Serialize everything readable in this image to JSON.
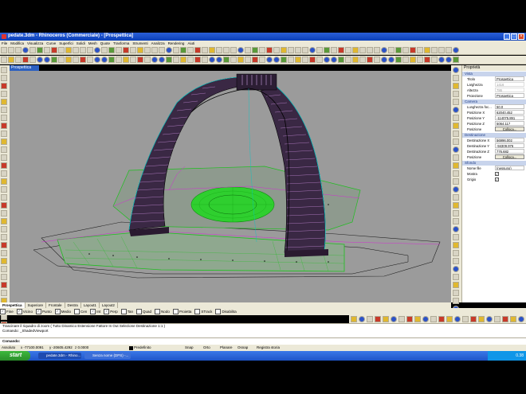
{
  "window": {
    "title": "pedate.3dm - Rhinoceros (Commerciale) - [Prospettica]"
  },
  "menu": [
    "File",
    "Modifica",
    "Visualizza",
    "Curve",
    "Superfici",
    "Solidi",
    "Mesh",
    "Quote",
    "Trasforma",
    "Strumenti",
    "Analizza",
    "Rendering",
    "Aiuti"
  ],
  "viewport": {
    "label": "Prospettica"
  },
  "properties": {
    "header": "Proprietà",
    "sections": {
      "view": "Vista",
      "camera": "Camera",
      "target": "Destinazione",
      "background": "Sfondo"
    },
    "view_rows": [
      {
        "k": "Titolo",
        "v": "Prospettica",
        "disabled": false
      },
      {
        "k": "Larghezza",
        "v": "1416",
        "disabled": true
      },
      {
        "k": "Altezza",
        "v": "786",
        "disabled": true
      },
      {
        "k": "Proiezione",
        "v": "Prospettica",
        "disabled": false
      }
    ],
    "camera_rows": [
      {
        "k": "Lunghezza foc...",
        "v": "50.0"
      },
      {
        "k": "Posizione X",
        "v": "62040.452"
      },
      {
        "k": "Posizione Y",
        "v": "-114075.891"
      },
      {
        "k": "Posizione Z",
        "v": "5064.117"
      }
    ],
    "camera_button_label": "Posizione",
    "camera_button": "Colloca...",
    "target_rows": [
      {
        "k": "Destinazione X",
        "v": "56996.002"
      },
      {
        "k": "Destinazione Y",
        "v": "-94309.976"
      },
      {
        "k": "Destinazione Z",
        "v": "776.682"
      }
    ],
    "target_button_label": "Posizione",
    "target_button": "Colloca...",
    "background_rows": [
      {
        "k": "Nome file",
        "v": "(nessuno)"
      },
      {
        "k": "Mostra",
        "v": "✓"
      },
      {
        "k": "Grigio",
        "v": "✓"
      }
    ]
  },
  "viewport_tabs": [
    "Prospettica",
    "Superiore",
    "Frontale",
    "Destra",
    "Layout1",
    "Layout2"
  ],
  "osnap": [
    {
      "label": "Fine",
      "checked": true
    },
    {
      "label": "Vicino",
      "checked": true
    },
    {
      "label": "Punto",
      "checked": true
    },
    {
      "label": "Medio",
      "checked": true
    },
    {
      "label": "Cen",
      "checked": false
    },
    {
      "label": "Int",
      "checked": true
    },
    {
      "label": "Perp",
      "checked": true
    },
    {
      "label": "Tan",
      "checked": false
    },
    {
      "label": "Quad",
      "checked": false
    },
    {
      "label": "Nodo",
      "checked": false
    },
    {
      "label": "Proietta",
      "checked": false
    },
    {
      "label": "STrack",
      "checked": false
    },
    {
      "label": "Disabilita",
      "checked": false
    }
  ],
  "command_history": [
    "Trascinare il riquadro di zoom ( Tutto  Dinamico  Estensione  Fattore  In  Out  Selezione  Destinazione  1:1 )",
    "Comando: _ShadedViewport"
  ],
  "command_prompt": "Comando:",
  "status": {
    "cplane": "Assoluto",
    "x": "x -77100.0091",
    "y": "y -20605.4292",
    "z": "z 0.0000",
    "layer": "Predefinito",
    "snap": "Snap",
    "orto": "Orto",
    "planare": "Planare",
    "osnap": "Osnap",
    "history": "Registra storia"
  },
  "taskbar": {
    "start": "start",
    "tasks": [
      "pedate.3dm - Rhino...",
      "Senza nome (DPS) -..."
    ],
    "clock": "0.38"
  },
  "colors": {
    "title_bar": "#0a3fb8",
    "viewport_bg": "#9b9b9b",
    "stair": "#5a3a62",
    "plan_green": "#2fcf2f",
    "taskbar": "#1f54c8",
    "start": "#2a8e2a"
  }
}
